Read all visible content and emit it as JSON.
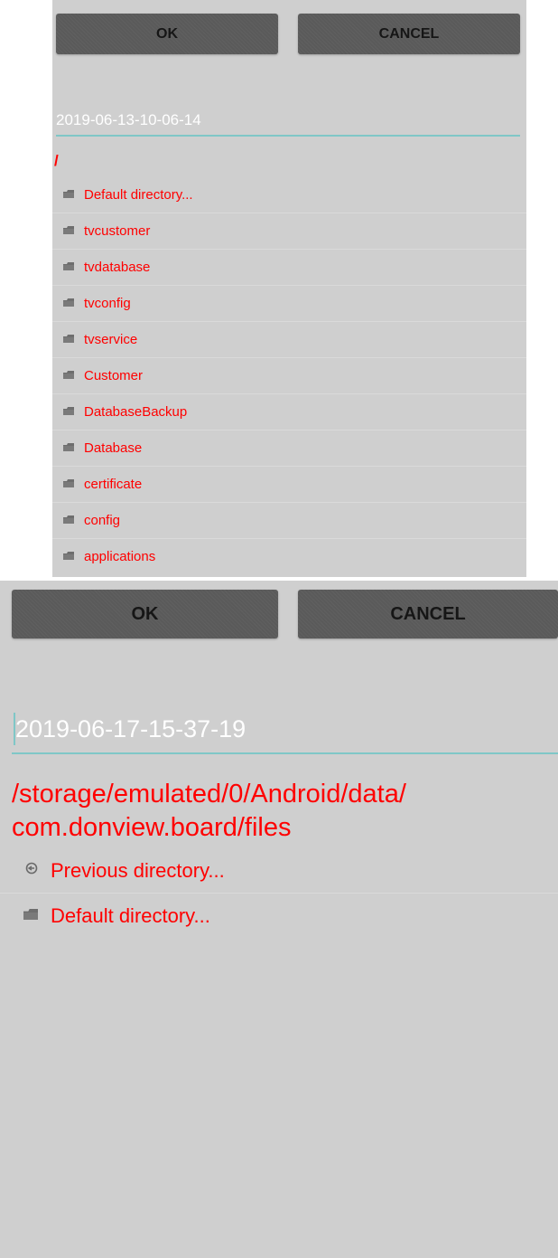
{
  "top_dialog": {
    "ok_label": "OK",
    "cancel_label": "CANCEL",
    "filename": "2019-06-13-10-06-14",
    "current_path": "/",
    "items": [
      {
        "label": "Default directory...",
        "icon": "folder-icon"
      },
      {
        "label": "tvcustomer",
        "icon": "folder-icon"
      },
      {
        "label": "tvdatabase",
        "icon": "folder-icon"
      },
      {
        "label": "tvconfig",
        "icon": "folder-icon"
      },
      {
        "label": "tvservice",
        "icon": "folder-icon"
      },
      {
        "label": "Customer",
        "icon": "folder-icon"
      },
      {
        "label": "DatabaseBackup",
        "icon": "folder-icon"
      },
      {
        "label": "Database",
        "icon": "folder-icon"
      },
      {
        "label": "certificate",
        "icon": "folder-icon"
      },
      {
        "label": "config",
        "icon": "folder-icon"
      },
      {
        "label": "applications",
        "icon": "folder-icon"
      }
    ]
  },
  "bottom_dialog": {
    "ok_label": "OK",
    "cancel_label": "CANCEL",
    "filename": "2019-06-17-15-37-19",
    "current_path_line1": "/storage/emulated/0/Android/data/",
    "current_path_line2": "com.donview.board/files",
    "items": [
      {
        "label": "Previous directory...",
        "icon": "up-directory-icon"
      },
      {
        "label": "Default directory...",
        "icon": "folder-icon"
      }
    ]
  },
  "colors": {
    "panel_bg": "#cfcfcf",
    "button_bg": "#5a5a5a",
    "path_text": "#ff0000",
    "filename_text": "#ffffff",
    "accent_underline": "#7fc7c7"
  }
}
